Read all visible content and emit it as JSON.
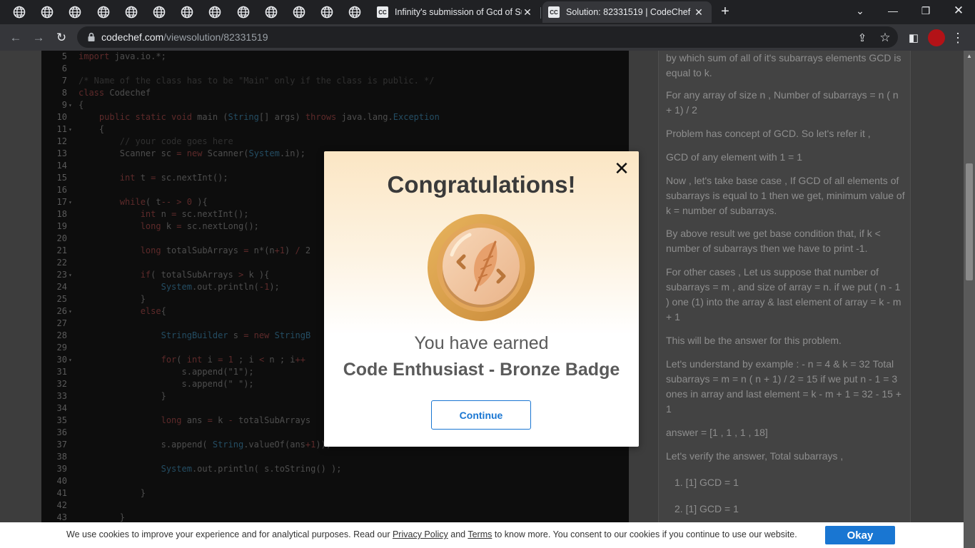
{
  "browser": {
    "mini_tab_count": 13,
    "tabs": [
      {
        "favicon": "CC",
        "title": "Infinity's submission of Gcd of Su"
      },
      {
        "favicon": "CC",
        "title": "Solution: 82331519 | CodeChef"
      }
    ],
    "url_host": "codechef.com",
    "url_path": "/viewsolution/82331519"
  },
  "code": {
    "lines": [
      {
        "n": "5",
        "fold": false,
        "html": "<span class='kw'>import</span> java.io.*;"
      },
      {
        "n": "6",
        "fold": false,
        "html": ""
      },
      {
        "n": "7",
        "fold": false,
        "html": "<span class='cm'>/* Name of the class has to be \"Main\" only if the class is public. */</span>"
      },
      {
        "n": "8",
        "fold": false,
        "html": "<span class='kw'>class</span> Codechef"
      },
      {
        "n": "9",
        "fold": true,
        "html": "{"
      },
      {
        "n": "10",
        "fold": false,
        "html": "    <span class='kw'>public static void</span> main (<span class='ty'>String</span>[] args) <span class='kw'>throws</span> java.lang.<span class='ty'>Exception</span>"
      },
      {
        "n": "11",
        "fold": true,
        "html": "    {"
      },
      {
        "n": "12",
        "fold": false,
        "html": "        <span class='cm'>// your code goes here</span>"
      },
      {
        "n": "13",
        "fold": false,
        "html": "        Scanner sc <span class='kw'>=</span> <span class='kw'>new</span> Scanner(<span class='ty'>System</span>.in);"
      },
      {
        "n": "14",
        "fold": false,
        "html": ""
      },
      {
        "n": "15",
        "fold": false,
        "html": "        <span class='kw'>int</span> t <span class='kw'>=</span> sc.nextInt();"
      },
      {
        "n": "16",
        "fold": false,
        "html": ""
      },
      {
        "n": "17",
        "fold": true,
        "html": "        <span class='kw'>while</span>( t<span class='kw'>--</span> <span class='kw'>&gt;</span> <span class='kw'>0</span> ){"
      },
      {
        "n": "18",
        "fold": false,
        "html": "            <span class='kw'>int</span> n <span class='kw'>=</span> sc.nextInt();"
      },
      {
        "n": "19",
        "fold": false,
        "html": "            <span class='kw'>long</span> k <span class='kw'>=</span> sc.nextLong();"
      },
      {
        "n": "20",
        "fold": false,
        "html": ""
      },
      {
        "n": "21",
        "fold": false,
        "html": "            <span class='kw'>long</span> totalSubArrays <span class='kw'>=</span> n*(n<span class='kw'>+1</span>) <span class='kw'>/</span> 2"
      },
      {
        "n": "22",
        "fold": false,
        "html": ""
      },
      {
        "n": "23",
        "fold": true,
        "html": "            <span class='kw'>if</span>( totalSubArrays <span class='kw'>&gt;</span> k ){"
      },
      {
        "n": "24",
        "fold": false,
        "html": "                <span class='ty'>System</span>.out.println(<span class='kw'>-1</span>);"
      },
      {
        "n": "25",
        "fold": false,
        "html": "            }"
      },
      {
        "n": "26",
        "fold": true,
        "html": "            <span class='kw'>else</span>{"
      },
      {
        "n": "27",
        "fold": false,
        "html": ""
      },
      {
        "n": "28",
        "fold": false,
        "html": "                <span class='ty'>StringBuilder</span> s <span class='kw'>=</span> <span class='kw'>new</span> <span class='ty'>StringB</span>"
      },
      {
        "n": "29",
        "fold": false,
        "html": ""
      },
      {
        "n": "30",
        "fold": true,
        "html": "                <span class='kw'>for</span>( <span class='kw'>int</span> i <span class='kw'>=</span> <span class='kw'>1</span> ; i <span class='kw'>&lt;</span> n ; i<span class='kw'>++</span>"
      },
      {
        "n": "31",
        "fold": false,
        "html": "                    s.append(<span class='st'>\"1\"</span>);"
      },
      {
        "n": "32",
        "fold": false,
        "html": "                    s.append(<span class='st'>\" \"</span>);"
      },
      {
        "n": "33",
        "fold": false,
        "html": "                }"
      },
      {
        "n": "34",
        "fold": false,
        "html": ""
      },
      {
        "n": "35",
        "fold": false,
        "html": "                <span class='kw'>long</span> ans <span class='kw'>=</span> k <span class='kw'>-</span> totalSubArrays"
      },
      {
        "n": "36",
        "fold": false,
        "html": ""
      },
      {
        "n": "37",
        "fold": false,
        "html": "                s.append( <span class='ty'>String</span>.valueOf(ans<span class='kw'>+1</span>));"
      },
      {
        "n": "38",
        "fold": false,
        "html": ""
      },
      {
        "n": "39",
        "fold": false,
        "html": "                <span class='ty'>System</span>.out.println( s.toString() );"
      },
      {
        "n": "40",
        "fold": false,
        "html": ""
      },
      {
        "n": "41",
        "fold": false,
        "html": "            }"
      },
      {
        "n": "42",
        "fold": false,
        "html": ""
      },
      {
        "n": "43",
        "fold": false,
        "html": "        }"
      }
    ]
  },
  "explanation": {
    "paragraphs": [
      "by which sum of all of it's subarrays elements GCD is equal to k.",
      "For any array of size n , Number of subarrays = n ( n + 1) / 2",
      "Problem has concept of GCD. So let's refer it ,",
      "GCD of any element with 1 = 1",
      "Now , let's take base case , If GCD of all elements of subarrays is equal to 1 then we get, minimum value of k = number of subarrays.",
      "By above result we get base condition that, if k < number of subarrays then we have to print -1.",
      "For other cases , Let us suppose that number of subarrays = m , and size of array = n. if we put ( n - 1 ) one (1) into the array & last element of array = k - m + 1",
      "This will be the answer for this problem.",
      "Let's understand by example : - n = 4 & k = 32 Total subarrays = m = n ( n + 1) / 2 = 15 if we put n - 1 = 3 ones in array and last element = k - m + 1 = 32 - 15 + 1",
      "answer = [1 , 1 , 1 , 18]",
      "Let's verify the answer, Total subarrays ,",
      "1. [1] GCD = 1",
      "2. [1] GCD = 1"
    ]
  },
  "modal": {
    "title": "Congratulations!",
    "earned": "You have earned",
    "badge_name": "Code Enthusiast - Bronze Badge",
    "continue_label": "Continue",
    "colors": {
      "accent": "#1976d2",
      "badge_outer": "#d9a04e",
      "badge_inner": "#f2c9a2"
    }
  },
  "cookie": {
    "text_before": "We use cookies to improve your experience and for analytical purposes. Read our ",
    "privacy_label": "Privacy Policy",
    "and_label": " and ",
    "terms_label": "Terms",
    "text_after": " to know more. You consent to our cookies if you continue to use our website.",
    "okay_label": "Okay"
  }
}
